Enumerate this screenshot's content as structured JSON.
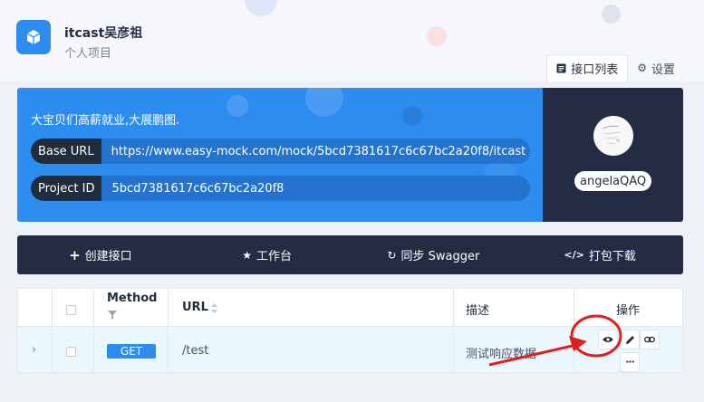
{
  "project": {
    "name": "itcast吴彦祖",
    "type": "个人项目"
  },
  "tabs": [
    {
      "label": "接口列表",
      "icon": "list-icon"
    },
    {
      "label": "设置",
      "icon": "gear-icon"
    }
  ],
  "info": {
    "description": "大宝贝们高薪就业,大展鹏图.",
    "base_url_label": "Base URL",
    "base_url_value": "https://www.easy-mock.com/mock/5bcd7381617c6c67bc2a20f8/itcast",
    "project_id_label": "Project ID",
    "project_id_value": "5bcd7381617c6c67bc2a20f8"
  },
  "user": {
    "name": "angelaQAQ"
  },
  "toolbar": {
    "create": "创建接口",
    "workspace": "工作台",
    "sync": "同步 Swagger",
    "download": "打包下载"
  },
  "table": {
    "headers": {
      "method": "Method",
      "url": "URL",
      "desc": "描述",
      "ops": "操作"
    },
    "rows": [
      {
        "method": "GET",
        "url": "/test",
        "desc": "测试响应数据"
      }
    ]
  },
  "colors": {
    "accent": "#2d8cf0",
    "dark": "#242c44",
    "annotation": "#e0201f"
  }
}
